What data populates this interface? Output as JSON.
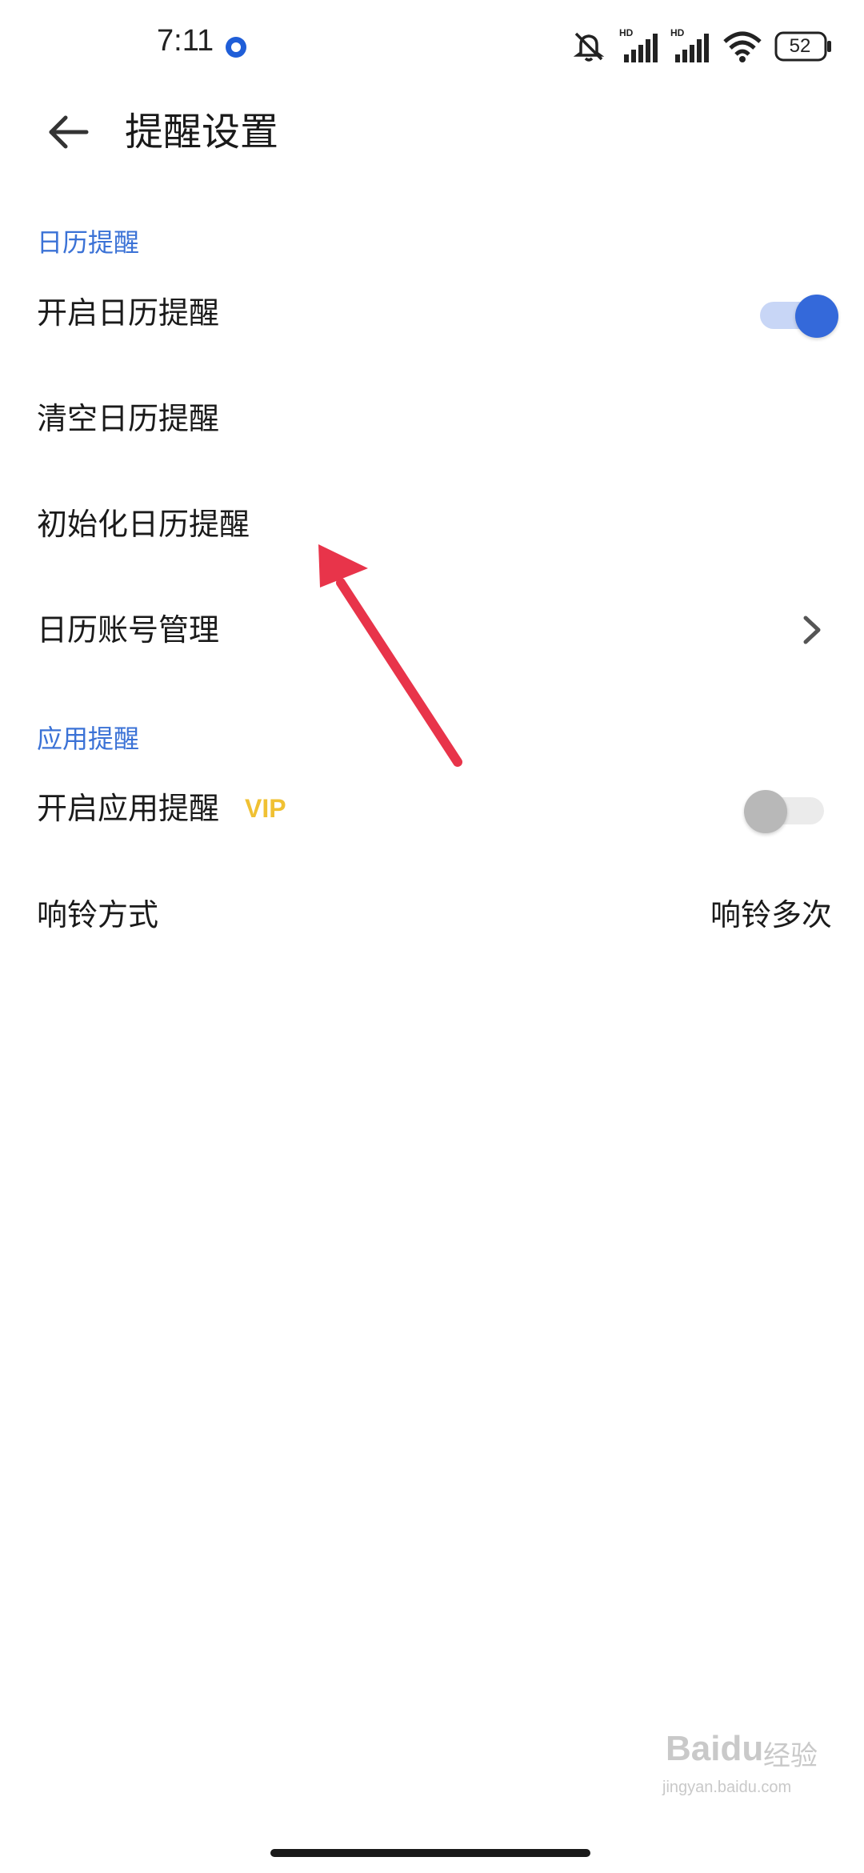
{
  "status_bar": {
    "time": "7:11",
    "battery": "52",
    "icons": [
      "mute-icon",
      "signal-hd-icon",
      "signal-hd-icon",
      "wifi-icon",
      "battery-icon"
    ]
  },
  "header": {
    "title": "提醒设置",
    "back_icon": "back-arrow-icon"
  },
  "calendar_section": {
    "title": "日历提醒",
    "items": [
      {
        "label": "开启日历提醒",
        "control": "toggle",
        "enabled": true
      },
      {
        "label": "清空日历提醒"
      },
      {
        "label": "初始化日历提醒"
      },
      {
        "label": "日历账号管理",
        "control": "chevron-right-icon"
      }
    ]
  },
  "app_section": {
    "title": "应用提醒",
    "items": [
      {
        "label": "开启应用提醒",
        "badge": "VIP",
        "control": "toggle",
        "enabled": false
      },
      {
        "label": "响铃方式",
        "value": "响铃多次"
      }
    ]
  },
  "watermark": {
    "brand": "Baidu",
    "brand_cn": "经验",
    "url": "jingyan.baidu.com"
  },
  "colors": {
    "accent": "#3469da",
    "section_title": "#3b72d6",
    "vip": "#f0c133",
    "annotation_arrow": "#e8344a"
  }
}
